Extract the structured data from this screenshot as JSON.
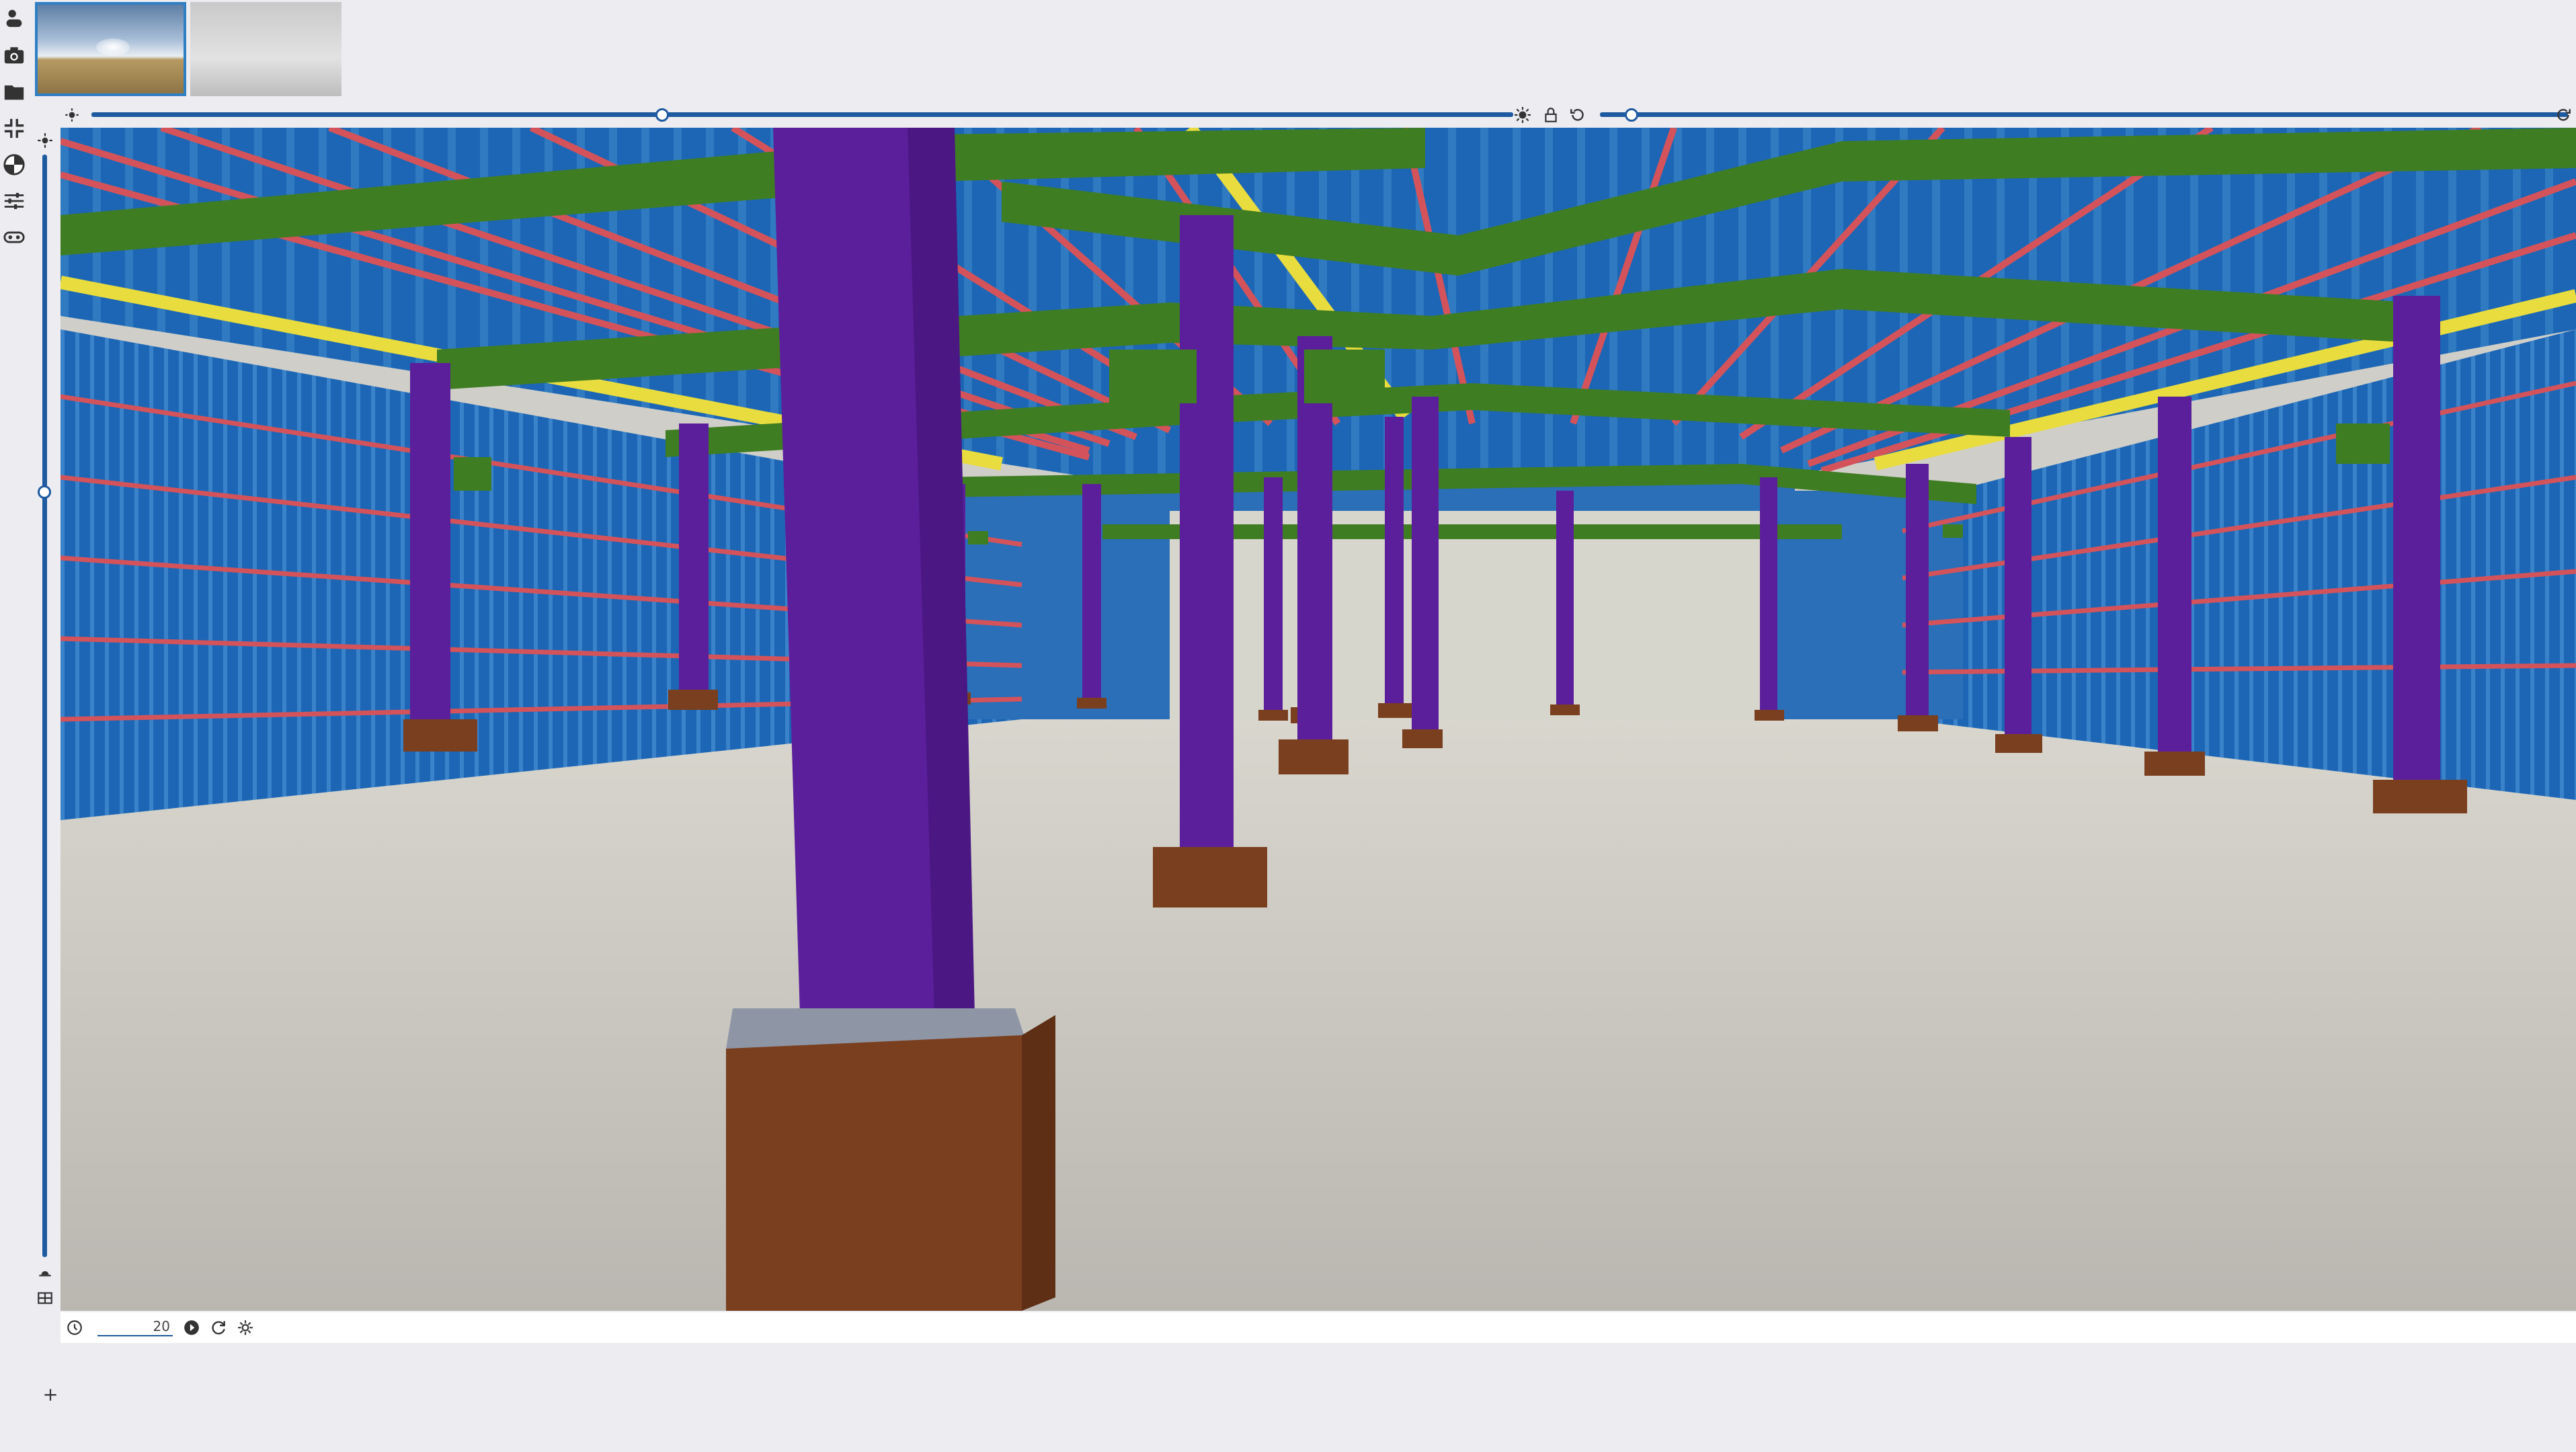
{
  "toolbar": {
    "items": [
      {
        "name": "environment",
        "icon": "weather-icon"
      },
      {
        "name": "camera",
        "icon": "camera-icon"
      },
      {
        "name": "folder",
        "icon": "folder-icon"
      },
      {
        "name": "collapse",
        "icon": "collapse-icon"
      },
      {
        "name": "materials",
        "icon": "material-ball-icon"
      },
      {
        "name": "adjust",
        "icon": "sliders-icon"
      },
      {
        "name": "vr",
        "icon": "vr-headset-icon"
      }
    ]
  },
  "environments": [
    {
      "name": "sky",
      "selected": true
    },
    {
      "name": "fog",
      "selected": false
    }
  ],
  "sliders": {
    "brightness": {
      "value": 0.42
    },
    "rotation": {
      "value": 0.03
    },
    "vertical": {
      "value": 0.27
    }
  },
  "timeline": {
    "frame_value": "20"
  },
  "colors": {
    "accent": "#1e5aa0",
    "column": "#5c1f9b",
    "beam": "#3f7d22",
    "purlin": "#d4535a",
    "cladding": "#1c66b5",
    "footing": "#7a3f1e",
    "floor": "#cfcec8"
  }
}
